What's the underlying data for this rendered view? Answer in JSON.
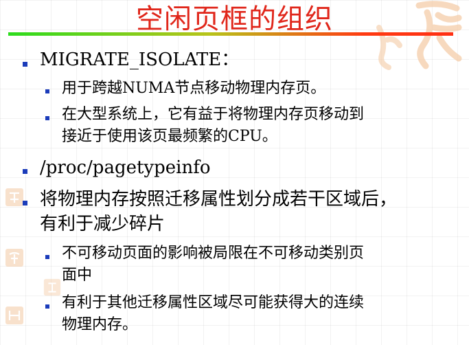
{
  "title": "空闲页框的组织",
  "bullets": [
    {
      "text": "MIGRATE_ISOLATE：",
      "sub": [
        {
          "lines": [
            "用于跨越NUMA节点移动物理内存页。"
          ]
        },
        {
          "lines": [
            "在大型系统上，它有益于将物理内存页移动到",
            "接近于使用该页最频繁的CPU。"
          ]
        }
      ]
    },
    {
      "text": "/proc/pagetypeinfo",
      "sub": []
    },
    {
      "lines": [
        "将物理内存按照迁移属性划分成若干区域后，",
        "有利于减少碎片"
      ],
      "sub": [
        {
          "lines": [
            "不可移动页面的影响被局限在不可移动类别页",
            "面中"
          ]
        },
        {
          "lines": [
            "有利于其他迁移属性区域尽可能获得大的连续",
            "物理内存。"
          ]
        }
      ]
    }
  ],
  "colors": {
    "title": "#e0261a",
    "bullet": "#1b3cba",
    "rule_start": "#2bdc1c",
    "rule_end": "#ff2f12",
    "watermark": "#f3c9a3"
  },
  "icons": {
    "bullet": "square-bullet",
    "watermark": "calligraphy-seal"
  }
}
